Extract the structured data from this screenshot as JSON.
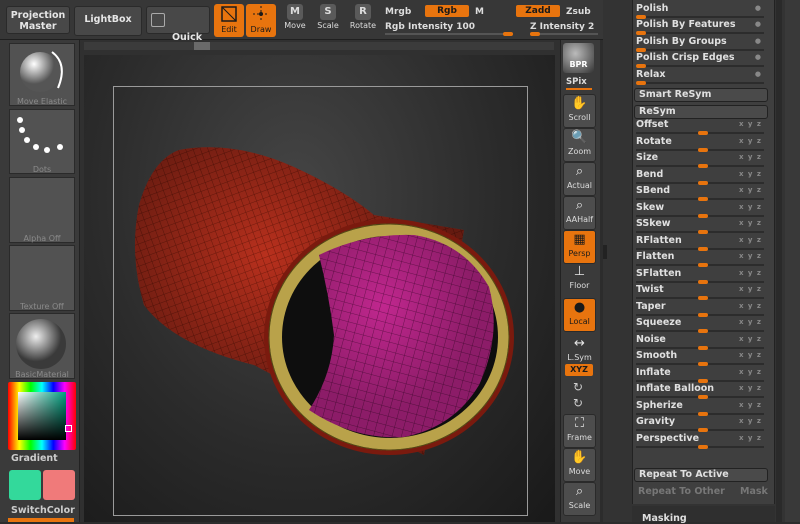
{
  "topbar": {
    "projection_master": "Projection\nMaster",
    "lightbox": "LightBox",
    "quick_sketch": "Quick\nSketch",
    "tools": [
      {
        "label": "Edit",
        "active": true
      },
      {
        "label": "Draw",
        "active": true
      },
      {
        "label": "Move",
        "active": false,
        "key": "M"
      },
      {
        "label": "Scale",
        "active": false,
        "key": "S"
      },
      {
        "label": "Rotate",
        "active": false,
        "key": "R"
      }
    ],
    "mrgb": "Mrgb",
    "rgb": "Rgb",
    "m": "M",
    "rgb_intensity": "Rgb Intensity 100",
    "zadd": "Zadd",
    "zsub": "Zsub",
    "z_intensity": "Z Intensity 2"
  },
  "leftpanel": {
    "items": [
      {
        "caption": "Move Elastic"
      },
      {
        "caption": "Dots"
      },
      {
        "caption": "Alpha Off"
      },
      {
        "caption": "Texture Off"
      },
      {
        "caption": "BasicMaterial"
      }
    ],
    "gradient": "Gradient",
    "switch_color": "SwitchColor",
    "colors": {
      "primary": "#33d99b",
      "secondary": "#f07a7a",
      "accent": "#e8740e"
    }
  },
  "rstrip": {
    "bpr": "BPR",
    "spix": "SPix",
    "buttons": [
      {
        "label": "Scroll",
        "icon": "hand-icon"
      },
      {
        "label": "Zoom",
        "icon": "zoom-icon"
      },
      {
        "label": "Actual",
        "icon": "actual-icon"
      },
      {
        "label": "AAHalf",
        "icon": "aahalf-icon"
      },
      {
        "label": "Persp",
        "icon": "persp-icon",
        "active": true
      },
      {
        "label": "Floor",
        "icon": "floor-icon"
      },
      {
        "label": "Local",
        "icon": "local-icon",
        "active": true
      },
      {
        "label": "L.Sym",
        "icon": "lsym-icon"
      },
      {
        "label": "XYZ",
        "icon": "xyz-icon",
        "active": true
      },
      {
        "label": "Frame",
        "icon": "frame-icon"
      },
      {
        "label": "Move",
        "icon": "move-icon"
      },
      {
        "label": "Scale",
        "icon": "scale-icon"
      }
    ]
  },
  "rpanel": {
    "polish": [
      {
        "label": "Polish"
      },
      {
        "label": "Polish By Features"
      },
      {
        "label": "Polish By Groups"
      },
      {
        "label": "Polish Crisp Edges"
      },
      {
        "label": "Relax"
      }
    ],
    "smart_resym": "Smart ReSym",
    "resym": "ReSym",
    "deformations": [
      {
        "label": "Offset"
      },
      {
        "label": "Rotate"
      },
      {
        "label": "Size"
      },
      {
        "label": "Bend"
      },
      {
        "label": "SBend"
      },
      {
        "label": "Skew"
      },
      {
        "label": "SSkew"
      },
      {
        "label": "RFlatten"
      },
      {
        "label": "Flatten"
      },
      {
        "label": "SFlatten"
      },
      {
        "label": "Twist"
      },
      {
        "label": "Taper"
      },
      {
        "label": "Squeeze"
      },
      {
        "label": "Noise"
      },
      {
        "label": "Smooth"
      },
      {
        "label": "Inflate"
      },
      {
        "label": "Inflate Balloon"
      },
      {
        "label": "Spherize"
      },
      {
        "label": "Gravity"
      },
      {
        "label": "Perspective"
      }
    ],
    "axes": "x y z",
    "repeat_to_active": "Repeat To Active",
    "repeat_to_other": "Repeat To Other",
    "mask": "Mask",
    "masking": "Masking"
  }
}
